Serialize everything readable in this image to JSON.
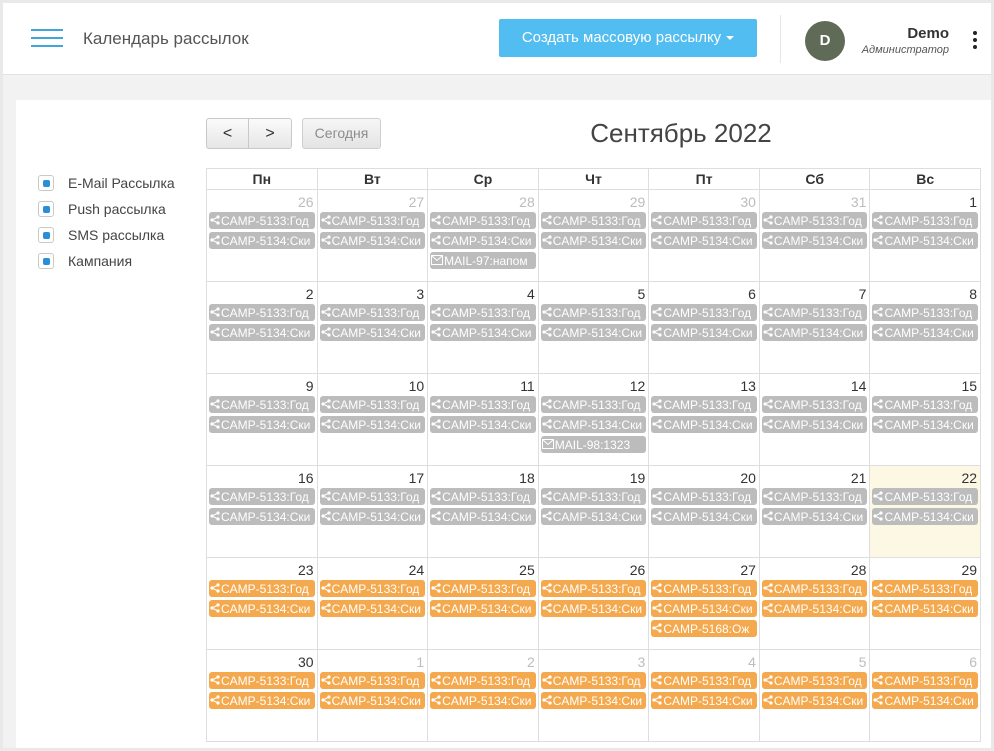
{
  "header": {
    "title": "Календарь рассылок",
    "create_button": "Создать массовую рассылку",
    "user": {
      "avatar_letter": "D",
      "name": "Demo",
      "role": "Администратор"
    }
  },
  "legend": [
    {
      "label": "E-Mail Рассылка"
    },
    {
      "label": "Push рассылка"
    },
    {
      "label": "SMS рассылка"
    },
    {
      "label": "Кампания"
    }
  ],
  "toolbar": {
    "prev": "<",
    "next": ">",
    "today": "Сегодня"
  },
  "calendar": {
    "month_title": "Сентябрь 2022",
    "weekdays": [
      "Пн",
      "Вт",
      "Ср",
      "Чт",
      "Пт",
      "Сб",
      "Вс"
    ],
    "weeks": [
      [
        {
          "day": "26",
          "other": true,
          "events": [
            {
              "text": "CAMP-5133:Год",
              "type": "campaign",
              "color": "gray"
            },
            {
              "text": "CAMP-5134:Ски",
              "type": "campaign",
              "color": "gray"
            }
          ]
        },
        {
          "day": "27",
          "other": true,
          "events": [
            {
              "text": "CAMP-5133:Год",
              "type": "campaign",
              "color": "gray"
            },
            {
              "text": "CAMP-5134:Ски",
              "type": "campaign",
              "color": "gray"
            }
          ]
        },
        {
          "day": "28",
          "other": true,
          "events": [
            {
              "text": "CAMP-5133:Год",
              "type": "campaign",
              "color": "gray"
            },
            {
              "text": "CAMP-5134:Ски",
              "type": "campaign",
              "color": "gray"
            },
            {
              "text": "MAIL-97:напом",
              "type": "mail",
              "color": "gray"
            }
          ]
        },
        {
          "day": "29",
          "other": true,
          "events": [
            {
              "text": "CAMP-5133:Год",
              "type": "campaign",
              "color": "gray"
            },
            {
              "text": "CAMP-5134:Ски",
              "type": "campaign",
              "color": "gray"
            }
          ]
        },
        {
          "day": "30",
          "other": true,
          "events": [
            {
              "text": "CAMP-5133:Год",
              "type": "campaign",
              "color": "gray"
            },
            {
              "text": "CAMP-5134:Ски",
              "type": "campaign",
              "color": "gray"
            }
          ]
        },
        {
          "day": "31",
          "other": true,
          "events": [
            {
              "text": "CAMP-5133:Год",
              "type": "campaign",
              "color": "gray"
            },
            {
              "text": "CAMP-5134:Ски",
              "type": "campaign",
              "color": "gray"
            }
          ]
        },
        {
          "day": "1",
          "other": false,
          "events": [
            {
              "text": "CAMP-5133:Год",
              "type": "campaign",
              "color": "gray"
            },
            {
              "text": "CAMP-5134:Ски",
              "type": "campaign",
              "color": "gray"
            }
          ]
        }
      ],
      [
        {
          "day": "2",
          "other": false,
          "events": [
            {
              "text": "CAMP-5133:Год",
              "type": "campaign",
              "color": "gray"
            },
            {
              "text": "CAMP-5134:Ски",
              "type": "campaign",
              "color": "gray"
            }
          ]
        },
        {
          "day": "3",
          "other": false,
          "events": [
            {
              "text": "CAMP-5133:Год",
              "type": "campaign",
              "color": "gray"
            },
            {
              "text": "CAMP-5134:Ски",
              "type": "campaign",
              "color": "gray"
            }
          ]
        },
        {
          "day": "4",
          "other": false,
          "events": [
            {
              "text": "CAMP-5133:Год",
              "type": "campaign",
              "color": "gray"
            },
            {
              "text": "CAMP-5134:Ски",
              "type": "campaign",
              "color": "gray"
            }
          ]
        },
        {
          "day": "5",
          "other": false,
          "events": [
            {
              "text": "CAMP-5133:Год",
              "type": "campaign",
              "color": "gray"
            },
            {
              "text": "CAMP-5134:Ски",
              "type": "campaign",
              "color": "gray"
            }
          ]
        },
        {
          "day": "6",
          "other": false,
          "events": [
            {
              "text": "CAMP-5133:Год",
              "type": "campaign",
              "color": "gray"
            },
            {
              "text": "CAMP-5134:Ски",
              "type": "campaign",
              "color": "gray"
            }
          ]
        },
        {
          "day": "7",
          "other": false,
          "events": [
            {
              "text": "CAMP-5133:Год",
              "type": "campaign",
              "color": "gray"
            },
            {
              "text": "CAMP-5134:Ски",
              "type": "campaign",
              "color": "gray"
            }
          ]
        },
        {
          "day": "8",
          "other": false,
          "events": [
            {
              "text": "CAMP-5133:Год",
              "type": "campaign",
              "color": "gray"
            },
            {
              "text": "CAMP-5134:Ски",
              "type": "campaign",
              "color": "gray"
            }
          ]
        }
      ],
      [
        {
          "day": "9",
          "other": false,
          "events": [
            {
              "text": "CAMP-5133:Год",
              "type": "campaign",
              "color": "gray"
            },
            {
              "text": "CAMP-5134:Ски",
              "type": "campaign",
              "color": "gray"
            }
          ]
        },
        {
          "day": "10",
          "other": false,
          "events": [
            {
              "text": "CAMP-5133:Год",
              "type": "campaign",
              "color": "gray"
            },
            {
              "text": "CAMP-5134:Ски",
              "type": "campaign",
              "color": "gray"
            }
          ]
        },
        {
          "day": "11",
          "other": false,
          "events": [
            {
              "text": "CAMP-5133:Год",
              "type": "campaign",
              "color": "gray"
            },
            {
              "text": "CAMP-5134:Ски",
              "type": "campaign",
              "color": "gray"
            }
          ]
        },
        {
          "day": "12",
          "other": false,
          "events": [
            {
              "text": "CAMP-5133:Год",
              "type": "campaign",
              "color": "gray"
            },
            {
              "text": "CAMP-5134:Ски",
              "type": "campaign",
              "color": "gray"
            },
            {
              "text": "MAIL-98:1323",
              "type": "mail",
              "color": "gray"
            }
          ]
        },
        {
          "day": "13",
          "other": false,
          "events": [
            {
              "text": "CAMP-5133:Год",
              "type": "campaign",
              "color": "gray"
            },
            {
              "text": "CAMP-5134:Ски",
              "type": "campaign",
              "color": "gray"
            }
          ]
        },
        {
          "day": "14",
          "other": false,
          "events": [
            {
              "text": "CAMP-5133:Год",
              "type": "campaign",
              "color": "gray"
            },
            {
              "text": "CAMP-5134:Ски",
              "type": "campaign",
              "color": "gray"
            }
          ]
        },
        {
          "day": "15",
          "other": false,
          "events": [
            {
              "text": "CAMP-5133:Год",
              "type": "campaign",
              "color": "gray"
            },
            {
              "text": "CAMP-5134:Ски",
              "type": "campaign",
              "color": "gray"
            }
          ]
        }
      ],
      [
        {
          "day": "16",
          "other": false,
          "events": [
            {
              "text": "CAMP-5133:Год",
              "type": "campaign",
              "color": "gray"
            },
            {
              "text": "CAMP-5134:Ски",
              "type": "campaign",
              "color": "gray"
            }
          ]
        },
        {
          "day": "17",
          "other": false,
          "events": [
            {
              "text": "CAMP-5133:Год",
              "type": "campaign",
              "color": "gray"
            },
            {
              "text": "CAMP-5134:Ски",
              "type": "campaign",
              "color": "gray"
            }
          ]
        },
        {
          "day": "18",
          "other": false,
          "events": [
            {
              "text": "CAMP-5133:Год",
              "type": "campaign",
              "color": "gray"
            },
            {
              "text": "CAMP-5134:Ски",
              "type": "campaign",
              "color": "gray"
            }
          ]
        },
        {
          "day": "19",
          "other": false,
          "events": [
            {
              "text": "CAMP-5133:Год",
              "type": "campaign",
              "color": "gray"
            },
            {
              "text": "CAMP-5134:Ски",
              "type": "campaign",
              "color": "gray"
            }
          ]
        },
        {
          "day": "20",
          "other": false,
          "events": [
            {
              "text": "CAMP-5133:Год",
              "type": "campaign",
              "color": "gray"
            },
            {
              "text": "CAMP-5134:Ски",
              "type": "campaign",
              "color": "gray"
            }
          ]
        },
        {
          "day": "21",
          "other": false,
          "events": [
            {
              "text": "CAMP-5133:Год",
              "type": "campaign",
              "color": "gray"
            },
            {
              "text": "CAMP-5134:Ски",
              "type": "campaign",
              "color": "gray"
            }
          ]
        },
        {
          "day": "22",
          "other": false,
          "today": true,
          "events": [
            {
              "text": "CAMP-5133:Год",
              "type": "campaign",
              "color": "gray"
            },
            {
              "text": "CAMP-5134:Ски",
              "type": "campaign",
              "color": "gray"
            }
          ]
        }
      ],
      [
        {
          "day": "23",
          "other": false,
          "events": [
            {
              "text": "CAMP-5133:Год",
              "type": "campaign",
              "color": "orange"
            },
            {
              "text": "CAMP-5134:Ски",
              "type": "campaign",
              "color": "orange"
            }
          ]
        },
        {
          "day": "24",
          "other": false,
          "events": [
            {
              "text": "CAMP-5133:Год",
              "type": "campaign",
              "color": "orange"
            },
            {
              "text": "CAMP-5134:Ски",
              "type": "campaign",
              "color": "orange"
            }
          ]
        },
        {
          "day": "25",
          "other": false,
          "events": [
            {
              "text": "CAMP-5133:Год",
              "type": "campaign",
              "color": "orange"
            },
            {
              "text": "CAMP-5134:Ски",
              "type": "campaign",
              "color": "orange"
            }
          ]
        },
        {
          "day": "26",
          "other": false,
          "events": [
            {
              "text": "CAMP-5133:Год",
              "type": "campaign",
              "color": "orange"
            },
            {
              "text": "CAMP-5134:Ски",
              "type": "campaign",
              "color": "orange"
            }
          ]
        },
        {
          "day": "27",
          "other": false,
          "events": [
            {
              "text": "CAMP-5133:Год",
              "type": "campaign",
              "color": "orange"
            },
            {
              "text": "CAMP-5134:Ски",
              "type": "campaign",
              "color": "orange"
            },
            {
              "text": "CAMP-5168:Ож",
              "type": "campaign",
              "color": "orange"
            }
          ]
        },
        {
          "day": "28",
          "other": false,
          "events": [
            {
              "text": "CAMP-5133:Год",
              "type": "campaign",
              "color": "orange"
            },
            {
              "text": "CAMP-5134:Ски",
              "type": "campaign",
              "color": "orange"
            }
          ]
        },
        {
          "day": "29",
          "other": false,
          "events": [
            {
              "text": "CAMP-5133:Год",
              "type": "campaign",
              "color": "orange"
            },
            {
              "text": "CAMP-5134:Ски",
              "type": "campaign",
              "color": "orange"
            }
          ]
        }
      ],
      [
        {
          "day": "30",
          "other": false,
          "events": [
            {
              "text": "CAMP-5133:Год",
              "type": "campaign",
              "color": "orange"
            },
            {
              "text": "CAMP-5134:Ски",
              "type": "campaign",
              "color": "orange"
            }
          ]
        },
        {
          "day": "1",
          "other": true,
          "events": [
            {
              "text": "CAMP-5133:Год",
              "type": "campaign",
              "color": "orange"
            },
            {
              "text": "CAMP-5134:Ски",
              "type": "campaign",
              "color": "orange"
            }
          ]
        },
        {
          "day": "2",
          "other": true,
          "events": [
            {
              "text": "CAMP-5133:Год",
              "type": "campaign",
              "color": "orange"
            },
            {
              "text": "CAMP-5134:Ски",
              "type": "campaign",
              "color": "orange"
            }
          ]
        },
        {
          "day": "3",
          "other": true,
          "events": [
            {
              "text": "CAMP-5133:Год",
              "type": "campaign",
              "color": "orange"
            },
            {
              "text": "CAMP-5134:Ски",
              "type": "campaign",
              "color": "orange"
            }
          ]
        },
        {
          "day": "4",
          "other": true,
          "events": [
            {
              "text": "CAMP-5133:Год",
              "type": "campaign",
              "color": "orange"
            },
            {
              "text": "CAMP-5134:Ски",
              "type": "campaign",
              "color": "orange"
            }
          ]
        },
        {
          "day": "5",
          "other": true,
          "events": [
            {
              "text": "CAMP-5133:Год",
              "type": "campaign",
              "color": "orange"
            },
            {
              "text": "CAMP-5134:Ски",
              "type": "campaign",
              "color": "orange"
            }
          ]
        },
        {
          "day": "6",
          "other": true,
          "events": [
            {
              "text": "CAMP-5133:Год",
              "type": "campaign",
              "color": "orange"
            },
            {
              "text": "CAMP-5134:Ски",
              "type": "campaign",
              "color": "orange"
            }
          ]
        }
      ]
    ]
  },
  "colors": {
    "accent": "#52bdf0",
    "menu": "#42a5dc",
    "event_past": "#bcbcbc",
    "event_future": "#f5a94e",
    "today_bg": "#fcf8e3",
    "avatar": "#5f6b56",
    "legend_dot": "#2b8ed6"
  }
}
